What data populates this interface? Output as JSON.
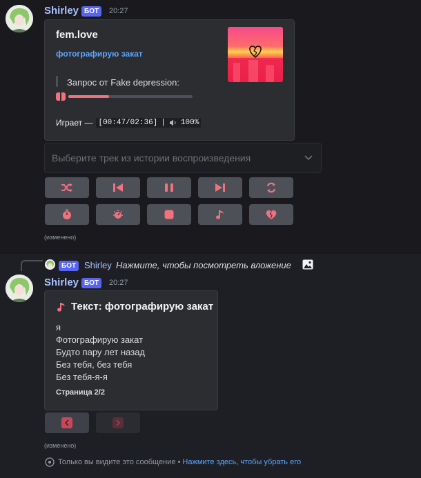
{
  "message1": {
    "username": "Shirley",
    "bot_tag": "БОТ",
    "timestamp": "20:27",
    "embed": {
      "author": "fem.love",
      "title": "фотографирую закат",
      "requester": "Запрос от Fake depression:",
      "progress": 0.33,
      "playing_label": "Играет —",
      "playing_time": "[00:47/02:36]",
      "separator": "|",
      "volume": "100%"
    },
    "select_placeholder": "Выберите трек из истории воспроизведения",
    "edited": "(изменено)"
  },
  "message2": {
    "reply": {
      "bot_tag": "БОТ",
      "username": "Shirley",
      "text": "Нажмите, чтобы посмотреть вложение"
    },
    "username": "Shirley",
    "bot_tag": "БОТ",
    "timestamp": "20:27",
    "embed": {
      "title": "Текст: фотографирую закат",
      "lines": [
        "я",
        "Фотографирую закат",
        "Будто пару лет назад",
        "Без тебя, без тебя",
        "Без тебя-я-я"
      ],
      "footer": "Страница 2/2"
    },
    "edited": "(изменено)",
    "ephemeral_text": "Только вы видите это сообщение •",
    "dismiss_link": "Нажмите здесь, чтобы убрать его"
  },
  "colors": {
    "accent": "#f0727e",
    "link": "#5aa6ff",
    "bot_badge": "#5865f2",
    "button": "#4e5058"
  }
}
